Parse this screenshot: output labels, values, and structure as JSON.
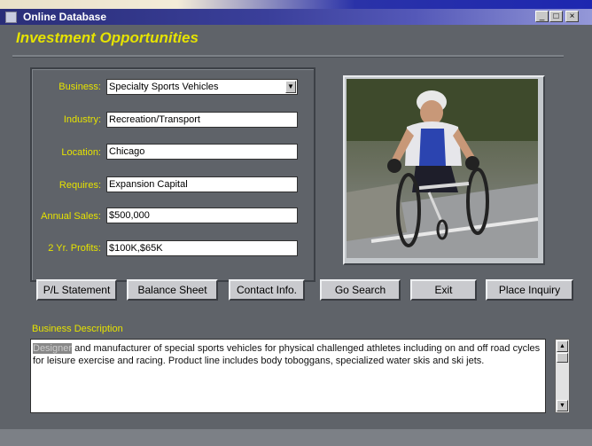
{
  "window": {
    "title": "Online Database"
  },
  "page": {
    "heading": "Investment Opportunities"
  },
  "form": {
    "fields": [
      {
        "label": "Business:",
        "value": "Specialty Sports Vehicles"
      },
      {
        "label": "Industry:",
        "value": "Recreation/Transport"
      },
      {
        "label": "Location:",
        "value": "Chicago"
      },
      {
        "label": "Requires:",
        "value": "Expansion Capital"
      },
      {
        "label": "Annual Sales:",
        "value": "$500,000"
      },
      {
        "label": "2 Yr. Profits:",
        "value": "$100K,$65K"
      }
    ]
  },
  "buttons": {
    "pl_statement": "P/L Statement",
    "balance_sheet": "Balance Sheet",
    "contact_info": "Contact Info.",
    "go_search": "Go Search",
    "exit": "Exit",
    "place_inquiry": "Place Inquiry"
  },
  "description": {
    "label": "Business Description",
    "highlight": "Designer",
    "text": " and manufacturer of special sports vehicles for physical challenged athletes including on and off road cycles for leisure exercise and racing. Product line includes body toboggans, specialized water skis and ski jets."
  },
  "colors": {
    "accent_label": "#e6e300",
    "background": "#5f6369"
  }
}
